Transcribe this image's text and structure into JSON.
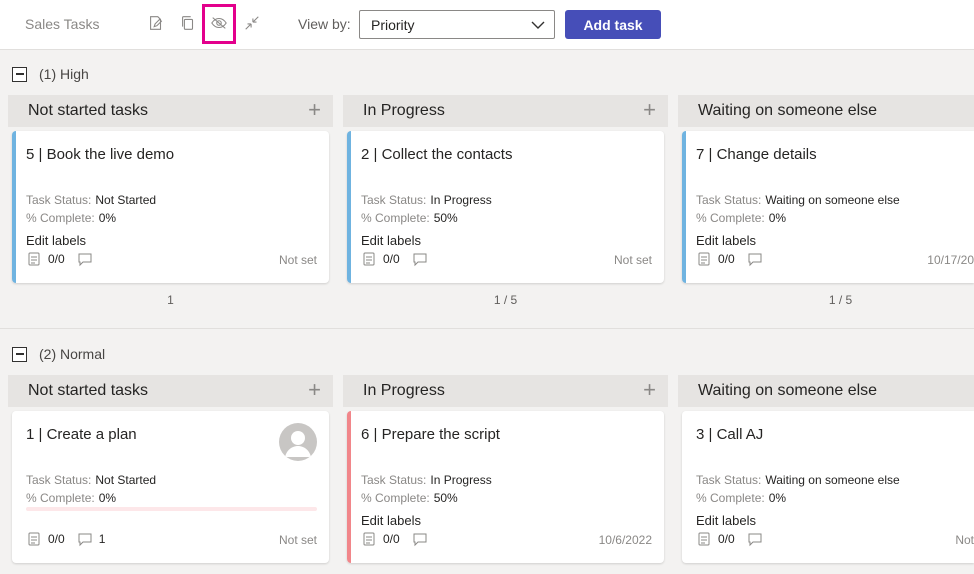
{
  "topbar": {
    "app_title": "Sales Tasks",
    "viewby_label": "View by:",
    "viewby_value": "Priority",
    "add_task_label": "Add task",
    "icons": [
      "edit-icon",
      "copy-icon",
      "hide-eye-icon",
      "collapse-icon"
    ]
  },
  "labels": {
    "task_status": "Task Status:",
    "complete": "% Complete:",
    "edit_labels": "Edit labels",
    "add": "+"
  },
  "groups": [
    {
      "name": "(1) High",
      "columns": [
        {
          "title": "Not started tasks",
          "footer": "1",
          "card": {
            "title": "5 | Book the live demo",
            "status": "Not Started",
            "complete": "0%",
            "checklist": "0/0",
            "comments": "",
            "date": "Not set",
            "stripe": "#6fb3e0"
          }
        },
        {
          "title": "In Progress",
          "footer": "1 / 5",
          "card": {
            "title": "2 | Collect the contacts",
            "status": "In Progress",
            "complete": "50%",
            "checklist": "0/0",
            "comments": "",
            "date": "Not set",
            "stripe": "#6fb3e0"
          }
        },
        {
          "title": "Waiting on someone else",
          "footer": "1 / 5",
          "card": {
            "title": "7 | Change details",
            "status": "Waiting on someone else",
            "complete": "0%",
            "checklist": "0/0",
            "comments": "",
            "date": "10/17/20",
            "stripe": "#6fb3e0"
          }
        }
      ]
    },
    {
      "name": "(2) Normal",
      "columns": [
        {
          "title": "Not started tasks",
          "card": {
            "title": "1 | Create a plan",
            "status": "Not Started",
            "complete": "0%",
            "checklist": "0/0",
            "comments": "1",
            "date": "Not set",
            "stripe": ""
          }
        },
        {
          "title": "In Progress",
          "card": {
            "title": "6 | Prepare the script",
            "status": "In Progress",
            "complete": "50%",
            "checklist": "0/0",
            "comments": "",
            "date": "10/6/2022",
            "stripe": "#f1868a"
          }
        },
        {
          "title": "Waiting on someone else",
          "card": {
            "title": "3 | Call AJ",
            "status": "Waiting on someone else",
            "complete": "0%",
            "checklist": "0/0",
            "comments": "",
            "date": "Not",
            "stripe": ""
          }
        }
      ]
    }
  ],
  "colors": {
    "accent": "#464eb8",
    "highlight": "#e3008c",
    "stripe_blue": "#6fb3e0",
    "stripe_red": "#f1868a"
  }
}
